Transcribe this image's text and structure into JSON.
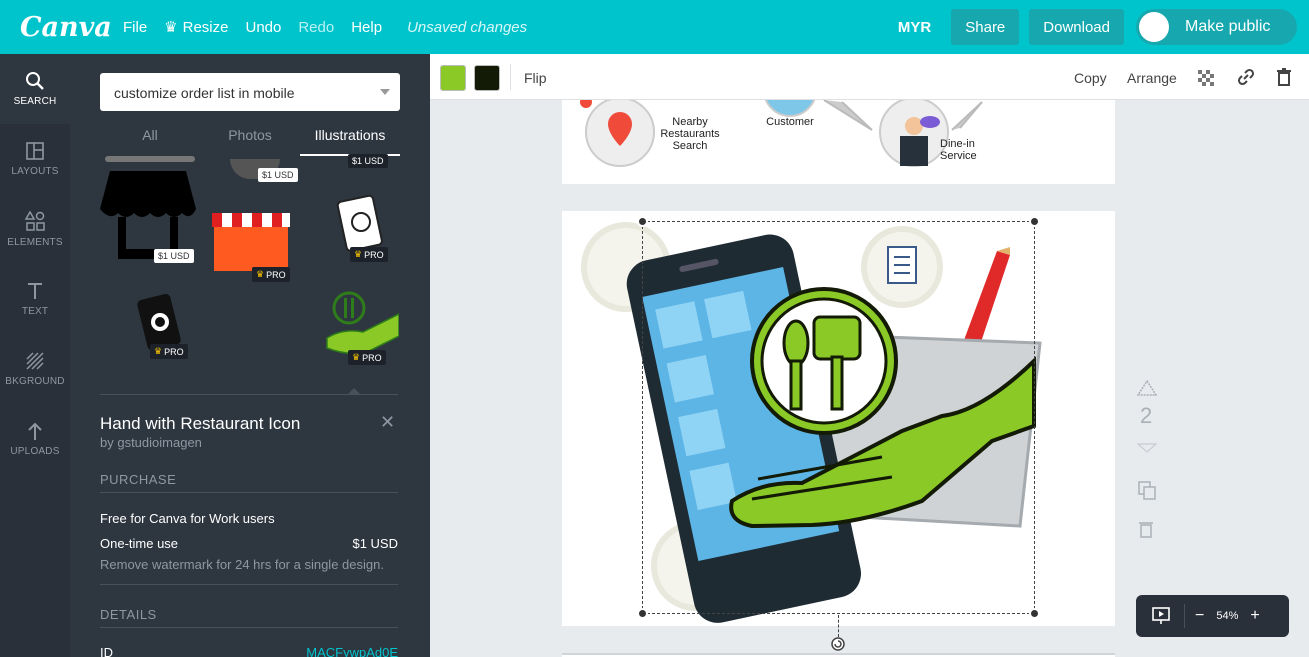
{
  "topbar": {
    "logo": "Canva",
    "menu": {
      "file": "File",
      "resize": "Resize",
      "undo": "Undo",
      "redo": "Redo",
      "help": "Help",
      "status": "Unsaved changes"
    },
    "currency": "MYR",
    "share": "Share",
    "download": "Download",
    "make_public": "Make public"
  },
  "sidebar": {
    "items": [
      {
        "label": "SEARCH",
        "icon": "search-icon"
      },
      {
        "label": "LAYOUTS",
        "icon": "layouts-icon"
      },
      {
        "label": "ELEMENTS",
        "icon": "elements-icon"
      },
      {
        "label": "TEXT",
        "icon": "text-icon"
      },
      {
        "label": "BKGROUND",
        "icon": "background-icon"
      },
      {
        "label": "UPLOADS",
        "icon": "upload-icon"
      }
    ]
  },
  "panel": {
    "search_value": "customize order list in mobile",
    "tabs": [
      "All",
      "Photos",
      "Illustrations"
    ],
    "badges": {
      "a": "$1 USD",
      "b": "$1 USD",
      "c": "$1 USD",
      "pro": "PRO"
    },
    "detail": {
      "title": "Hand with Restaurant Icon",
      "author": "by gstudioimagen",
      "purchase_header": "PURCHASE",
      "free_text": "Free for Canva for Work users",
      "onetime_label": "One-time use",
      "onetime_price": "$1 USD",
      "watermark_note": "Remove watermark for 24 hrs for a single design.",
      "details_header": "DETAILS",
      "id_label": "ID",
      "id_value": "MACFywpAd0E"
    }
  },
  "context_toolbar": {
    "colors": [
      "#8ac926",
      "#131a06"
    ],
    "flip": "Flip",
    "copy": "Copy",
    "arrange": "Arrange"
  },
  "canvas": {
    "page1": {
      "labels": {
        "nearby": "Nearby Restaurants Search",
        "customer": "Customer",
        "dinein": "Dine-in Service"
      }
    },
    "page_number": "2"
  },
  "zoom": {
    "minus": "−",
    "value": "54%",
    "plus": "+"
  },
  "colors": {
    "accent": "#00c4cc",
    "green": "#8ac926"
  }
}
